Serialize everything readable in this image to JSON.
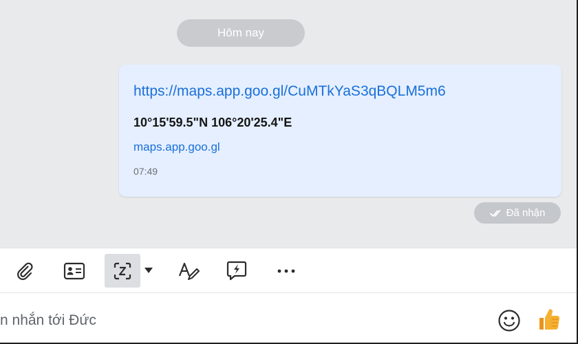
{
  "chat": {
    "date_divider": "Hôm nay",
    "message": {
      "link": "https://maps.app.goo.gl/CuMTkYaS3qBQLM5m6",
      "coordinates": "10°15'59.5\"N 106°20'25.4\"E",
      "domain": "maps.app.goo.gl",
      "time": "07:49"
    },
    "status": "Đã nhận"
  },
  "toolbar": {
    "tools": [
      {
        "name": "attach-icon"
      },
      {
        "name": "contact-card-icon"
      },
      {
        "name": "screenshot-icon",
        "active": true
      },
      {
        "name": "caret-down-icon"
      },
      {
        "name": "text-format-icon"
      },
      {
        "name": "quick-message-icon"
      },
      {
        "name": "more-icon"
      }
    ]
  },
  "composer": {
    "placeholder": "n nhắn tới Đức"
  },
  "colors": {
    "link": "#1a6fd9",
    "bubble": "#e5efff",
    "background": "#e9eaec",
    "like": "#f5a623"
  }
}
